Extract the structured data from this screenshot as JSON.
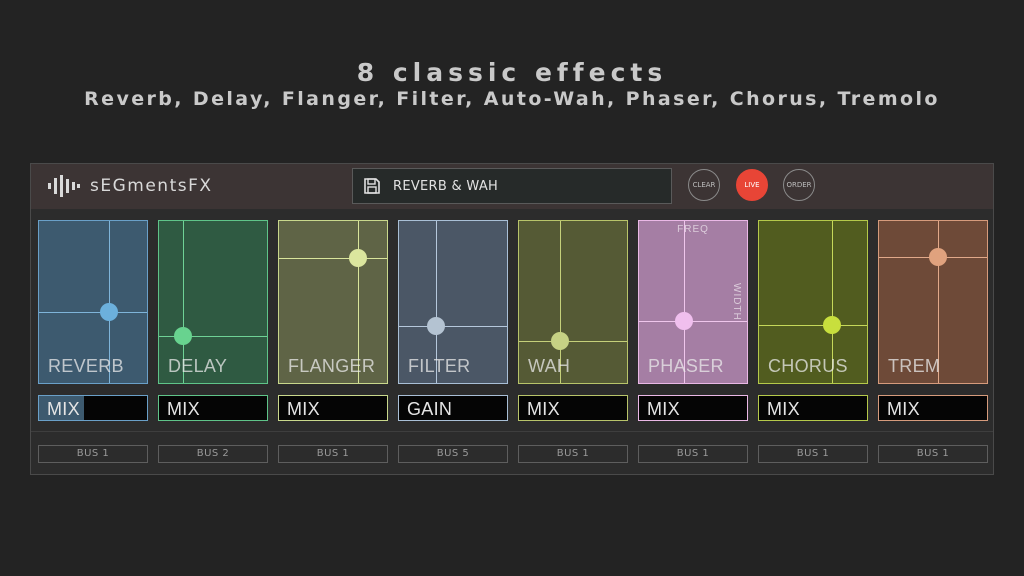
{
  "headline": {
    "title": "8 classic effects",
    "subtitle": "Reverb, Delay, Flanger, Filter, Auto-Wah, Phaser, Chorus, Tremolo"
  },
  "app": {
    "name": "sEGmentsFX",
    "preset_name": "REVERB & WAH",
    "buttons": {
      "clear": "CLEAR",
      "live": "LIVE",
      "order": "ORDER"
    }
  },
  "modules": [
    {
      "name": "REVERB",
      "control": "MIX",
      "control_level": 0.42,
      "bus": "BUS 1",
      "knob": [
        0.65,
        0.56
      ],
      "color": "#3d5a6f",
      "border": "#6aa0c8",
      "line": "#7fb4d9",
      "knob_color": "#6cb0dc"
    },
    {
      "name": "DELAY",
      "control": "MIX",
      "control_level": 0,
      "bus": "BUS 2",
      "knob": [
        0.22,
        0.71
      ],
      "color": "#2f5a42",
      "border": "#5fc489",
      "line": "#6fd296",
      "knob_color": "#68d38f"
    },
    {
      "name": "FLANGER",
      "control": "MIX",
      "control_level": 0,
      "bus": "BUS 1",
      "knob": [
        0.73,
        0.23
      ],
      "color": "#5f6446",
      "border": "#c9d88c",
      "line": "#d9e59c",
      "knob_color": "#dbe69e"
    },
    {
      "name": "FILTER",
      "control": "GAIN",
      "control_level": 0,
      "bus": "BUS 5",
      "knob": [
        0.34,
        0.65
      ],
      "color": "#4b5766",
      "border": "#a9bfd6",
      "line": "#b6c8dc",
      "knob_color": "#b4c3d2"
    },
    {
      "name": "WAH",
      "control": "MIX",
      "control_level": 0,
      "bus": "BUS 1",
      "knob": [
        0.38,
        0.74
      ],
      "color": "#555a35",
      "border": "#b8c46a",
      "line": "#c5d07a",
      "knob_color": "#c6d184"
    },
    {
      "name": "PHASER",
      "control": "MIX",
      "control_level": 0,
      "bus": "BUS 1",
      "knob": [
        0.42,
        0.62
      ],
      "color": "#a57ea4",
      "border": "#eab8e6",
      "line": "#efc6ec",
      "knob_color": "#f0bfee",
      "freq_label": "FREQ",
      "width_label": "WIDTH"
    },
    {
      "name": "CHORUS",
      "control": "MIX",
      "control_level": 0,
      "bus": "BUS 1",
      "knob": [
        0.68,
        0.64
      ],
      "color": "#515c1f",
      "border": "#b5c94a",
      "line": "#c6d85a",
      "knob_color": "#c8df3d"
    },
    {
      "name": "TREM",
      "control": "MIX",
      "control_level": 0,
      "bus": "BUS 1",
      "knob": [
        0.55,
        0.22
      ],
      "color": "#6e4a38",
      "border": "#d69b7c",
      "line": "#e1a98a",
      "knob_color": "#e0a27e"
    }
  ]
}
